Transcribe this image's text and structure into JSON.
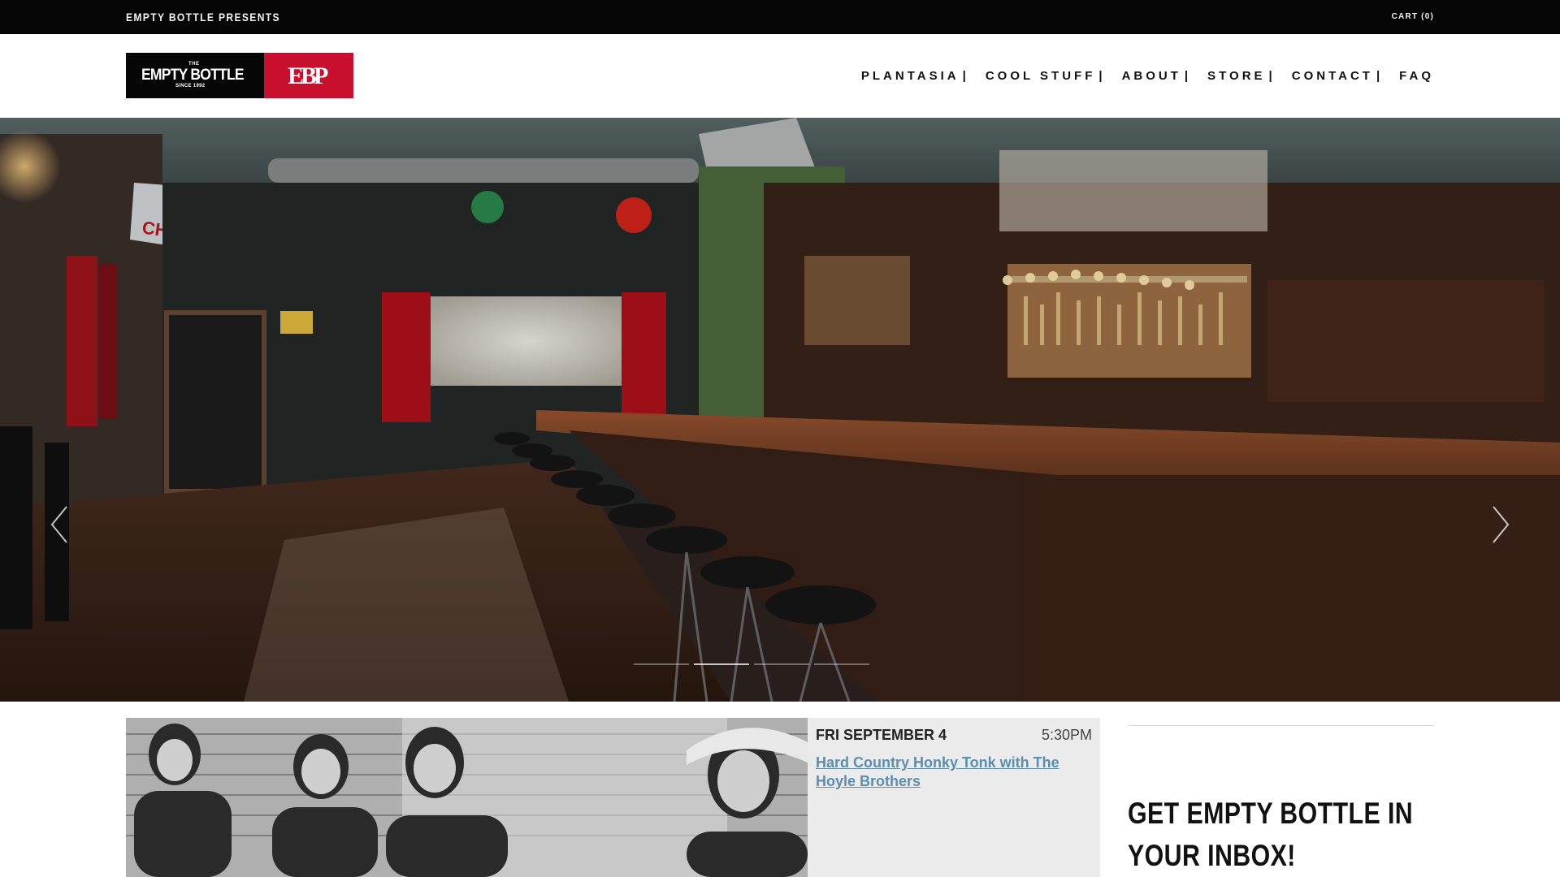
{
  "topbar": {
    "presents": "EMPTY BOTTLE PRESENTS",
    "cart": "CART (0)"
  },
  "logo": {
    "the": "THE",
    "name": "EMPTY BOTTLE",
    "since": "SINCE 1992",
    "badge": "EBP",
    "colors": {
      "left": "#060606",
      "right": "#c8102e"
    }
  },
  "nav": {
    "items": [
      {
        "label": "PLANTASIA"
      },
      {
        "label": "COOL STUFF"
      },
      {
        "label": "ABOUT"
      },
      {
        "label": "STORE"
      },
      {
        "label": "CONTACT"
      },
      {
        "label": "FAQ"
      }
    ],
    "separator": "|"
  },
  "hero": {
    "prev_icon": "chevron-left-icon",
    "next_icon": "chevron-right-icon",
    "slide_count": 4,
    "active_slide": 2
  },
  "event": {
    "date": "FRI SEPTEMBER 4",
    "time": "5:30PM",
    "title": "Hard Country Honky Tonk with The Hoyle Brothers",
    "title_color": "#5b8eb0"
  },
  "sidebar": {
    "heading": "GET EMPTY BOTTLE IN YOUR INBOX!"
  }
}
